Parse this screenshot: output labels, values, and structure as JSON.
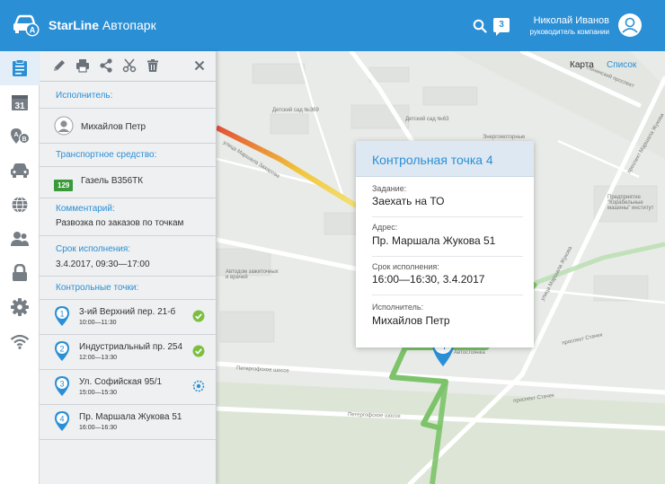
{
  "header": {
    "brand_bold": "StarLine",
    "brand_rest": " Автопарк",
    "notifications": "3",
    "user_name": "Николай Иванов",
    "user_role": "руководитель компании",
    "accent": "#2b8fd5"
  },
  "nav": {
    "calendar_day": "31",
    "items": [
      "clipboard-icon",
      "calendar-icon",
      "route-icon",
      "car-icon",
      "globe-icon",
      "users-icon",
      "lock-icon",
      "gear-icon",
      "wifi-icon"
    ]
  },
  "panel": {
    "toolbar": [
      "edit-icon",
      "print-icon",
      "share-icon",
      "cut-icon",
      "trash-icon",
      "close-icon"
    ],
    "executor_label": "Исполнитель:",
    "executor_name": "Михайлов Петр",
    "vehicle_label": "Транспортное средство:",
    "vehicle_plate": "129",
    "vehicle_name": "Газель В356ТК",
    "comment_label": "Комментарий:",
    "comment_text": "Развозка по заказов по точкам",
    "deadline_label": "Срок исполнения:",
    "deadline_text": "3.4.2017, 09:30—17:00",
    "checkpoints_label": "Контрольные точки:",
    "checkpoints": [
      {
        "num": "1",
        "title": "3-ий Верхний пер. 21-б",
        "time": "10:00—11:30",
        "status": "done"
      },
      {
        "num": "2",
        "title": "Индустриальный пр. 254",
        "time": "12:00—13:30",
        "status": "done"
      },
      {
        "num": "3",
        "title": "Ул. Софийская 95/1",
        "time": "15:00—15:30",
        "status": "in-progress"
      },
      {
        "num": "4",
        "title": "Пр. Маршала Жукова 51",
        "time": "16:00—16:30",
        "status": "pending"
      }
    ]
  },
  "map": {
    "tab_map": "Карта",
    "tab_list": "Список",
    "marker_num": "4",
    "labels": {
      "l1": "Ленинский проспект",
      "l2": "Детский сад №369",
      "l3": "Детский сад №63",
      "l4": "Энергомоторные",
      "l5": "улица Маршала Захарова",
      "l6": "Предприятие \"Корабельные машины\" институт",
      "l7": "проспект Маршала Жукова",
      "l8": "улица Маршала Жукова",
      "l9": "Автодом зажиточных и врачей",
      "l10": "проспект Стачек",
      "l11": "Петергофское шоссе",
      "l12": "Петергофское шоссе",
      "l13": "проспект Стачек",
      "l14": "Автостоянка"
    }
  },
  "popup": {
    "title": "Контрольная точка 4",
    "task_label": "Задание:",
    "task_value": "Заехать на ТО",
    "address_label": "Адрес:",
    "address_value": "Пр. Маршала Жукова 51",
    "deadline_label": "Срок исполнения:",
    "deadline_value": "16:00—16:30, 3.4.2017",
    "executor_label": "Исполнитель:",
    "executor_value": "Михайлов Петр"
  }
}
